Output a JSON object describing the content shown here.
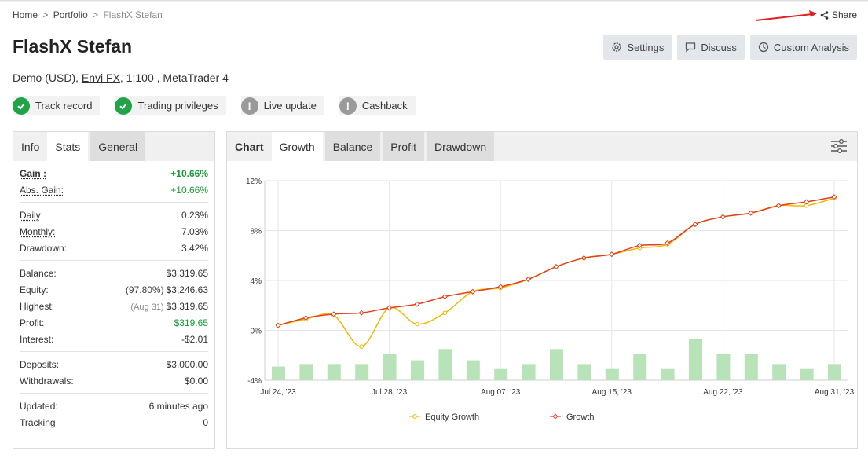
{
  "breadcrumb": {
    "home": "Home",
    "separator": ">",
    "portfolio": "Portfolio",
    "current": "FlashX Stefan"
  },
  "share_label": "Share",
  "title": "FlashX Stefan",
  "subtitle": {
    "currency": "Demo (USD),",
    "broker": "Envi FX",
    "details": ", 1:100 , MetaTrader 4"
  },
  "actions": {
    "settings": "Settings",
    "discuss": "Discuss",
    "custom_analysis": "Custom Analysis"
  },
  "badges": [
    {
      "label": "Track record",
      "status": "ok"
    },
    {
      "label": "Trading privileges",
      "status": "ok"
    },
    {
      "label": "Live update",
      "status": "warn"
    },
    {
      "label": "Cashback",
      "status": "warn"
    }
  ],
  "left_tabs": {
    "info": "Info",
    "stats": "Stats",
    "general": "General"
  },
  "stats": {
    "gain_label": "Gain :",
    "gain": "+10.66%",
    "abs_gain_label": "Abs. Gain:",
    "abs_gain": "+10.66%",
    "daily_label": "Daily",
    "daily": "0.23%",
    "monthly_label": "Monthly:",
    "monthly": "7.03%",
    "drawdown_label": "Drawdown:",
    "drawdown": "3.42%",
    "balance_label": "Balance:",
    "balance": "$3,319.65",
    "equity_label": "Equity:",
    "equity_pct": "(97.80%)",
    "equity": "$3,246.63",
    "highest_label": "Highest:",
    "highest_date": "(Aug 31)",
    "highest": "$3,319.65",
    "profit_label": "Profit:",
    "profit": "$319.65",
    "interest_label": "Interest:",
    "interest": "-$2.01",
    "deposits_label": "Deposits:",
    "deposits": "$3,000.00",
    "withdrawals_label": "Withdrawals:",
    "withdrawals": "$0.00",
    "updated_label": "Updated:",
    "updated": "6 minutes ago",
    "tracking_label": "Tracking",
    "tracking": "0"
  },
  "chart_tabs": {
    "chart": "Chart",
    "growth": "Growth",
    "balance": "Balance",
    "profit": "Profit",
    "drawdown": "Drawdown"
  },
  "colors": {
    "equity": "#f5b800",
    "growth": "#e0401c",
    "bars": "#b8e2b8",
    "positive": "#1a9a37"
  },
  "chart_data": {
    "type": "line",
    "y_ticks": [
      "12%",
      "8%",
      "4%",
      "0%",
      "-4%"
    ],
    "ylim": [
      -4,
      12
    ],
    "x_ticks": [
      "Jul 24, '23",
      "Jul 28, '23",
      "Aug 07, '23",
      "Aug 15, '23",
      "Aug 22, '23",
      "Aug 31, '23"
    ],
    "series": [
      {
        "name": "Equity Growth",
        "values": [
          0.4,
          0.9,
          1.2,
          -1.3,
          1.8,
          0.5,
          1.4,
          3.1,
          3.4,
          4.1,
          5.1,
          5.8,
          6.1,
          6.6,
          6.9,
          8.5,
          9.1,
          9.4,
          10.0,
          10.0,
          10.6
        ]
      },
      {
        "name": "Growth",
        "values": [
          0.4,
          1.0,
          1.3,
          1.4,
          1.8,
          2.1,
          2.7,
          3.1,
          3.5,
          4.1,
          5.1,
          5.8,
          6.1,
          6.8,
          7.0,
          8.5,
          9.1,
          9.4,
          10.0,
          10.3,
          10.7
        ]
      }
    ],
    "bars": [
      1.1,
      1.3,
      1.3,
      1.3,
      2.1,
      1.6,
      2.5,
      1.6,
      0.9,
      1.3,
      2.5,
      1.3,
      0.9,
      2.1,
      0.9,
      3.3,
      2.1,
      2.1,
      1.3,
      0.9,
      1.3
    ]
  }
}
